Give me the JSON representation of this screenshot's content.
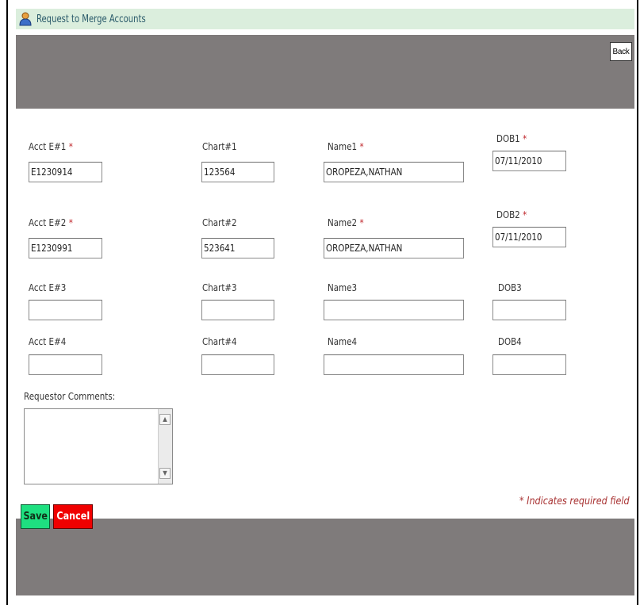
{
  "header": {
    "title": "Request to Merge Accounts",
    "back_label": "Back"
  },
  "form": {
    "rows": [
      {
        "acct_label": "Acct E#1",
        "acct_required": true,
        "acct_value": "E1230914",
        "chart_label": "Chart#1",
        "chart_value": "123564",
        "name_label": "Name1",
        "name_required": true,
        "name_value": "OROPEZA,NATHAN",
        "dob_label": "DOB1",
        "dob_required": true,
        "dob_value": "07/11/2010"
      },
      {
        "acct_label": "Acct E#2",
        "acct_required": true,
        "acct_value": "E1230991",
        "chart_label": "Chart#2",
        "chart_value": "523641",
        "name_label": "Name2",
        "name_required": true,
        "name_value": "OROPEZA,NATHAN",
        "dob_label": "DOB2",
        "dob_required": true,
        "dob_value": "07/11/2010"
      },
      {
        "acct_label": "Acct E#3",
        "acct_required": false,
        "acct_value": "",
        "chart_label": "Chart#3",
        "chart_value": "",
        "name_label": "Name3",
        "name_required": false,
        "name_value": "",
        "dob_label": "DOB3",
        "dob_required": false,
        "dob_value": ""
      },
      {
        "acct_label": "Acct E#4",
        "acct_required": false,
        "acct_value": "",
        "chart_label": "Chart#4",
        "chart_value": "",
        "name_label": "Name4",
        "name_required": false,
        "name_value": "",
        "dob_label": "DOB4",
        "dob_required": false,
        "dob_value": ""
      }
    ],
    "required_marker": "*",
    "comments_label": "Requestor Comments:",
    "comments_value": "",
    "required_note": "* Indicates required field"
  },
  "footer": {
    "save_label": "Save",
    "cancel_label": "Cancel"
  },
  "colors": {
    "title_bar_bg": "#dbeedd",
    "band_gray": "#7f7b7b",
    "save_green": "#1ee080",
    "cancel_red": "#f00000",
    "required_red": "#c0282d"
  },
  "icons": {
    "title_icon": "user-icon",
    "scroll_up": "arrow-up-icon",
    "scroll_down": "arrow-down-icon"
  }
}
